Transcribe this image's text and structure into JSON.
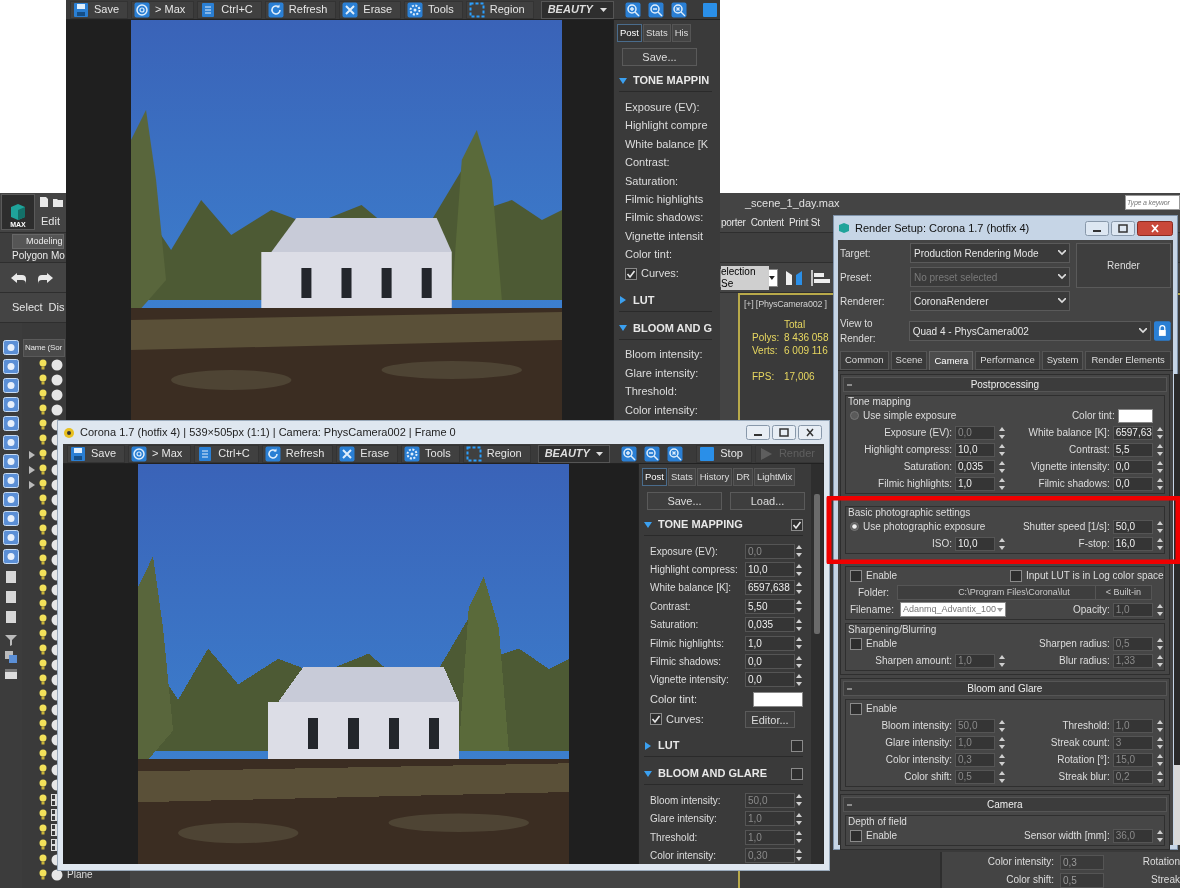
{
  "desktop": {
    "search_placeholder": "Type a keywor"
  },
  "max_window": {
    "title": "_scene_1_day.max",
    "logo_label": "MAX",
    "left_menus": [
      "Edit"
    ],
    "right_menus": [
      "porter",
      "Content",
      "Print St"
    ],
    "ribbon_tab": "Modeling",
    "ribbon_panel": "Polygon Mo",
    "explorer_toolbar": [
      "Select",
      "Dis"
    ],
    "explorer_header": "Name (Sor",
    "selection_set": "election Se",
    "explorer_rows": [
      {
        "kind": "object"
      },
      {
        "kind": "object"
      },
      {
        "kind": "object"
      },
      {
        "kind": "object"
      },
      {
        "kind": "object"
      },
      {
        "kind": "object"
      },
      {
        "kind": "group"
      },
      {
        "kind": "group"
      },
      {
        "kind": "group"
      },
      {
        "kind": "object"
      },
      {
        "kind": "object"
      },
      {
        "kind": "object"
      },
      {
        "kind": "object"
      },
      {
        "kind": "object"
      },
      {
        "kind": "object"
      },
      {
        "kind": "object"
      },
      {
        "kind": "object"
      },
      {
        "kind": "object"
      },
      {
        "kind": "object"
      },
      {
        "kind": "object"
      },
      {
        "kind": "object"
      },
      {
        "kind": "object"
      },
      {
        "kind": "object"
      },
      {
        "kind": "object"
      },
      {
        "kind": "object"
      },
      {
        "kind": "object"
      },
      {
        "kind": "object"
      },
      {
        "kind": "object"
      },
      {
        "kind": "object"
      },
      {
        "kind": "helper"
      },
      {
        "kind": "helper"
      },
      {
        "kind": "helper"
      },
      {
        "kind": "helper"
      },
      {
        "kind": "object"
      },
      {
        "kind": "object",
        "name": "Plane"
      }
    ],
    "viewport": {
      "label": "[+] [PhysCamera002 ]",
      "stats_header": "Total",
      "stats": [
        {
          "label": "Polys:",
          "value": "8 436 058"
        },
        {
          "label": "Verts:",
          "value": "6 009 116"
        }
      ],
      "fps_label": "FPS:",
      "fps_value": "17,006"
    }
  },
  "back_rollout": {
    "rows": [
      {
        "label": "Color intensity:",
        "value": "0,3",
        "right_label": "Rotation"
      },
      {
        "label": "Color shift:",
        "value": "0,5",
        "right_label": "Streak"
      }
    ]
  },
  "vfb_back": {
    "toolbar": [
      {
        "kind": "save",
        "label": "Save"
      },
      {
        "kind": "max",
        "label": "> Max"
      },
      {
        "kind": "copy",
        "label": "Ctrl+C"
      },
      {
        "kind": "refresh",
        "label": "Refresh"
      },
      {
        "kind": "erase",
        "label": "Erase"
      },
      {
        "kind": "tools",
        "label": "Tools"
      },
      {
        "kind": "region",
        "label": "Region"
      },
      {
        "kind": "dropdown",
        "label": "BEAUTY"
      },
      {
        "kind": "zoom-in"
      },
      {
        "kind": "zoom-out"
      },
      {
        "kind": "zoom-fit"
      },
      {
        "kind": "stop"
      }
    ],
    "tabs": [
      {
        "label": "Post",
        "selected": true
      },
      {
        "label": "Stats",
        "selected": false
      },
      {
        "label": "His",
        "selected": false
      }
    ],
    "buttons": [
      "Save..."
    ],
    "rows": [
      {
        "kind": "section",
        "label": "TONE MAPPIN",
        "expanded": true
      },
      {
        "kind": "field",
        "label": "Exposure (EV):"
      },
      {
        "kind": "field",
        "label": "Highlight compre"
      },
      {
        "kind": "field",
        "label": "White balance [K"
      },
      {
        "kind": "field",
        "label": "Contrast:"
      },
      {
        "kind": "field",
        "label": "Saturation:"
      },
      {
        "kind": "field",
        "label": "Filmic highlights"
      },
      {
        "kind": "field",
        "label": "Filmic shadows:"
      },
      {
        "kind": "field",
        "label": "Vignette intensit"
      },
      {
        "kind": "field",
        "label": "Color tint:"
      },
      {
        "kind": "check",
        "label": "Curves:",
        "checked": true
      },
      {
        "kind": "section",
        "label": "LUT",
        "expanded": false
      },
      {
        "kind": "section",
        "label": "BLOOM AND G",
        "expanded": true
      },
      {
        "kind": "field",
        "label": "Bloom intensity:"
      },
      {
        "kind": "field",
        "label": "Glare intensity:"
      },
      {
        "kind": "field",
        "label": "Threshold:"
      },
      {
        "kind": "field",
        "label": "Color intensity:"
      }
    ]
  },
  "vfb_front": {
    "title": "Corona 1.7 (hotfix 4) | 539×505px (1:1) | Camera: PhysCamera002 | Frame 0",
    "toolbar": [
      {
        "kind": "save",
        "label": "Save",
        "disabled": false
      },
      {
        "kind": "max",
        "label": "> Max",
        "disabled": false
      },
      {
        "kind": "copy",
        "label": "Ctrl+C",
        "disabled": false
      },
      {
        "kind": "refresh",
        "label": "Refresh",
        "disabled": false
      },
      {
        "kind": "erase",
        "label": "Erase",
        "disabled": false
      },
      {
        "kind": "tools",
        "label": "Tools",
        "disabled": false
      },
      {
        "kind": "region",
        "label": "Region",
        "disabled": false
      },
      {
        "kind": "dropdown",
        "label": "BEAUTY",
        "disabled": false
      },
      {
        "kind": "zoom-in",
        "disabled": false
      },
      {
        "kind": "zoom-out",
        "disabled": false
      },
      {
        "kind": "zoom-fit",
        "disabled": false
      },
      {
        "kind": "stop",
        "label": "Stop",
        "disabled": false
      },
      {
        "kind": "render",
        "label": "Render",
        "disabled": true
      }
    ],
    "tabs": [
      {
        "label": "Post",
        "selected": true
      },
      {
        "label": "Stats",
        "selected": false
      },
      {
        "label": "History",
        "selected": false
      },
      {
        "label": "DR",
        "selected": false
      },
      {
        "label": "LightMix",
        "selected": false
      }
    ],
    "buttons": [
      "Save...",
      "Load..."
    ],
    "rows": [
      {
        "kind": "section",
        "label": "TONE MAPPING",
        "expanded": true,
        "enabled": true
      },
      {
        "kind": "field",
        "label": "Exposure (EV):",
        "value": "0,0",
        "disabled": true
      },
      {
        "kind": "field",
        "label": "Highlight compress:",
        "value": "10,0",
        "disabled": false
      },
      {
        "kind": "field",
        "label": "White balance [K]:",
        "value": "6597,638",
        "disabled": false
      },
      {
        "kind": "field",
        "label": "Contrast:",
        "value": "5,50",
        "disabled": false
      },
      {
        "kind": "field",
        "label": "Saturation:",
        "value": "0,035",
        "disabled": false
      },
      {
        "kind": "field",
        "label": "Filmic highlights:",
        "value": "1,0",
        "disabled": false
      },
      {
        "kind": "field",
        "label": "Filmic shadows:",
        "value": "0,0",
        "disabled": false
      },
      {
        "kind": "field",
        "label": "Vignette intensity:",
        "value": "0,0",
        "disabled": false
      },
      {
        "kind": "swatch",
        "label": "Color tint:"
      },
      {
        "kind": "check",
        "label": "Curves:",
        "checked": true,
        "button": "Editor..."
      },
      {
        "kind": "section",
        "label": "LUT",
        "expanded": false,
        "enabled": false
      },
      {
        "kind": "section",
        "label": "BLOOM AND GLARE",
        "expanded": true,
        "enabled": false
      },
      {
        "kind": "field",
        "label": "Bloom intensity:",
        "value": "50,0",
        "disabled": true
      },
      {
        "kind": "field",
        "label": "Glare intensity:",
        "value": "1,0",
        "disabled": true
      },
      {
        "kind": "field",
        "label": "Threshold:",
        "value": "1,0",
        "disabled": true
      },
      {
        "kind": "field",
        "label": "Color intensity:",
        "value": "0,30",
        "disabled": true
      }
    ]
  },
  "render_setup": {
    "title": "Render Setup: Corona 1.7 (hotfix 4)",
    "rows": [
      {
        "label": "Target:",
        "value": "Production Rendering Mode",
        "disabled": false
      },
      {
        "label": "Preset:",
        "value": "No preset selected",
        "disabled": true
      },
      {
        "label": "Renderer:",
        "value": "CoronaRenderer",
        "disabled": false
      }
    ],
    "render_button": "Render",
    "view_label": "View to Render:",
    "view_value": "Quad 4 - PhysCamera002",
    "tabs": [
      {
        "label": "Common",
        "selected": false
      },
      {
        "label": "Scene",
        "selected": false
      },
      {
        "label": "Camera",
        "selected": true
      },
      {
        "label": "Performance",
        "selected": false
      },
      {
        "label": "System",
        "selected": false
      },
      {
        "label": "Render Elements",
        "selected": false
      }
    ],
    "rollouts": [
      {
        "title": "Postprocessing",
        "groups": [
          {
            "title": "Tone mapping",
            "rows": [
              [
                {
                  "kind": "radio",
                  "label": "Use simple exposure",
                  "selected": false
                },
                {
                  "kind": "swatch",
                  "label": "Color tint:"
                }
              ],
              [
                {
                  "kind": "spinner",
                  "label": "Exposure (EV):",
                  "value": "0,0",
                  "disabled": true
                },
                {
                  "kind": "spinner",
                  "label": "White balance [K]:",
                  "value": "6597,63",
                  "disabled": false
                }
              ],
              [
                {
                  "kind": "spinner",
                  "label": "Highlight compress:",
                  "value": "10,0",
                  "disabled": false
                },
                {
                  "kind": "spinner",
                  "label": "Contrast:",
                  "value": "5,5",
                  "disabled": false
                }
              ],
              [
                {
                  "kind": "spinner",
                  "label": "Saturation:",
                  "value": "0,035",
                  "disabled": false
                },
                {
                  "kind": "spinner",
                  "label": "Vignette intensity:",
                  "value": "0,0",
                  "disabled": false
                }
              ],
              [
                {
                  "kind": "spinner",
                  "label": "Filmic highlights:",
                  "value": "1,0",
                  "disabled": false
                },
                {
                  "kind": "spinner",
                  "label": "Filmic shadows:",
                  "value": "0,0",
                  "disabled": false
                }
              ]
            ]
          },
          {
            "title": "Basic photographic settings",
            "rows": [
              [
                {
                  "kind": "radio",
                  "label": "Use photographic exposure",
                  "selected": true
                },
                {
                  "kind": "spinner",
                  "label": "Shutter speed [1/s]:",
                  "value": "50,0",
                  "disabled": false
                }
              ],
              [
                {
                  "kind": "spinner",
                  "label": "ISO:",
                  "value": "10,0",
                  "disabled": false
                },
                {
                  "kind": "spinner",
                  "label": "F-stop:",
                  "value": "16,0",
                  "disabled": false
                }
              ]
            ]
          },
          {
            "rows": [
              [
                {
                  "kind": "checkbox",
                  "label": "Enable",
                  "checked": false
                },
                {
                  "kind": "checkbox",
                  "label": "Input LUT is in Log color space",
                  "checked": false
                }
              ],
              [
                {
                  "kind": "folder",
                  "label": "Folder:",
                  "value": "C:\\Program Files\\Corona\\lut",
                  "button": "< Built-in"
                }
              ],
              [
                {
                  "kind": "dropdown",
                  "label": "Filename:",
                  "value": "Adanmq_Advantix_100"
                },
                {
                  "kind": "spinner",
                  "label": "Opacity:",
                  "value": "1,0",
                  "disabled": true
                }
              ]
            ]
          },
          {
            "title": "Sharpening/Blurring",
            "rows": [
              [
                {
                  "kind": "checkbox",
                  "label": "Enable",
                  "checked": false
                },
                {
                  "kind": "spinner",
                  "label": "Sharpen radius:",
                  "value": "0,5",
                  "disabled": true
                }
              ],
              [
                {
                  "kind": "spinner",
                  "label": "Sharpen amount:",
                  "value": "1,0",
                  "disabled": true
                },
                {
                  "kind": "spinner",
                  "label": "Blur radius:",
                  "value": "1,33",
                  "disabled": true
                }
              ]
            ]
          }
        ]
      },
      {
        "title": "Bloom and Glare",
        "groups": [
          {
            "rows": [
              [
                {
                  "kind": "checkbox",
                  "label": "Enable",
                  "checked": false
                }
              ],
              [
                {
                  "kind": "spinner",
                  "label": "Bloom intensity:",
                  "value": "50,0",
                  "disabled": true
                },
                {
                  "kind": "spinner",
                  "label": "Threshold:",
                  "value": "1,0",
                  "disabled": true
                }
              ],
              [
                {
                  "kind": "spinner",
                  "label": "Glare intensity:",
                  "value": "1,0",
                  "disabled": true
                },
                {
                  "kind": "spinner",
                  "label": "Streak count:",
                  "value": "3",
                  "disabled": true
                }
              ],
              [
                {
                  "kind": "spinner",
                  "label": "Color intensity:",
                  "value": "0,3",
                  "disabled": true
                },
                {
                  "kind": "spinner",
                  "label": "Rotation [°]:",
                  "value": "15,0",
                  "disabled": true
                }
              ],
              [
                {
                  "kind": "spinner",
                  "label": "Color shift:",
                  "value": "0,5",
                  "disabled": true
                },
                {
                  "kind": "spinner",
                  "label": "Streak blur:",
                  "value": "0,2",
                  "disabled": true
                }
              ]
            ]
          }
        ]
      },
      {
        "title": "Camera",
        "groups": [
          {
            "title": "Depth of field",
            "rows": [
              [
                {
                  "kind": "checkbox",
                  "label": "Enable",
                  "checked": false
                },
                {
                  "kind": "spinner",
                  "label": "Sensor width [mm]:",
                  "value": "36,0",
                  "disabled": true
                }
              ]
            ]
          }
        ]
      }
    ]
  }
}
